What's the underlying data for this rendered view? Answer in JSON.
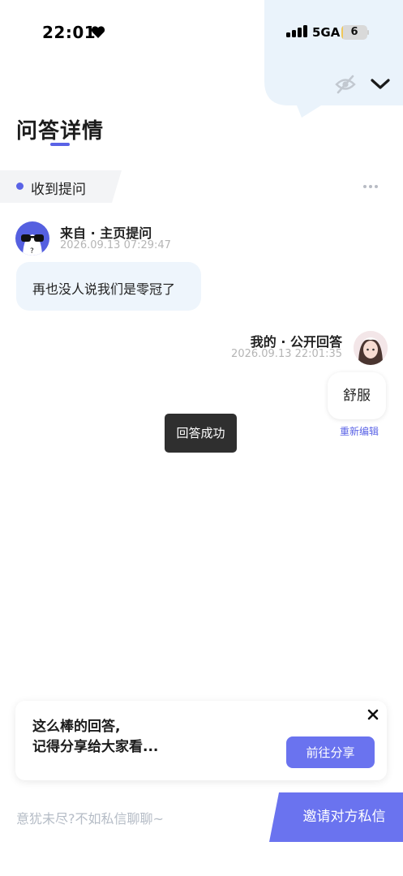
{
  "status_bar": {
    "time": "22:01",
    "network": "5GA",
    "battery": "6",
    "battery_level": 0.06,
    "icons": [
      "heart-icon",
      "signal-icon",
      "battery-icon"
    ]
  },
  "header": {
    "title": "问答详情",
    "icons": [
      "eye-off-icon",
      "chevron-down-icon"
    ]
  },
  "section": {
    "label": "收到提问",
    "more_icon": "more-icon"
  },
  "question": {
    "from": "来自 · 主页提问",
    "time": "2026.09.13 07:29:47",
    "text": "再也没人说我们是零冠了"
  },
  "answer": {
    "author": "我的 · 公开回答",
    "time": "2026.09.13 22:01:35",
    "text": "舒服",
    "edit_label": "重新编辑"
  },
  "toast": {
    "text": "回答成功"
  },
  "share_card": {
    "line1": "这么棒的回答,",
    "line2": "记得分享给大家看...",
    "button": "前往分享"
  },
  "bottom_bar": {
    "placeholder": "意犹未尽?不如私信聊聊~",
    "invite_button": "邀请对方私信"
  },
  "colors": {
    "accent": "#5a63e6",
    "button": "#6a73ef",
    "bubble": "#eef5fc",
    "corner": "#eaf3fb",
    "toast": "#2f2f2f",
    "battery": "#f0c85a"
  }
}
